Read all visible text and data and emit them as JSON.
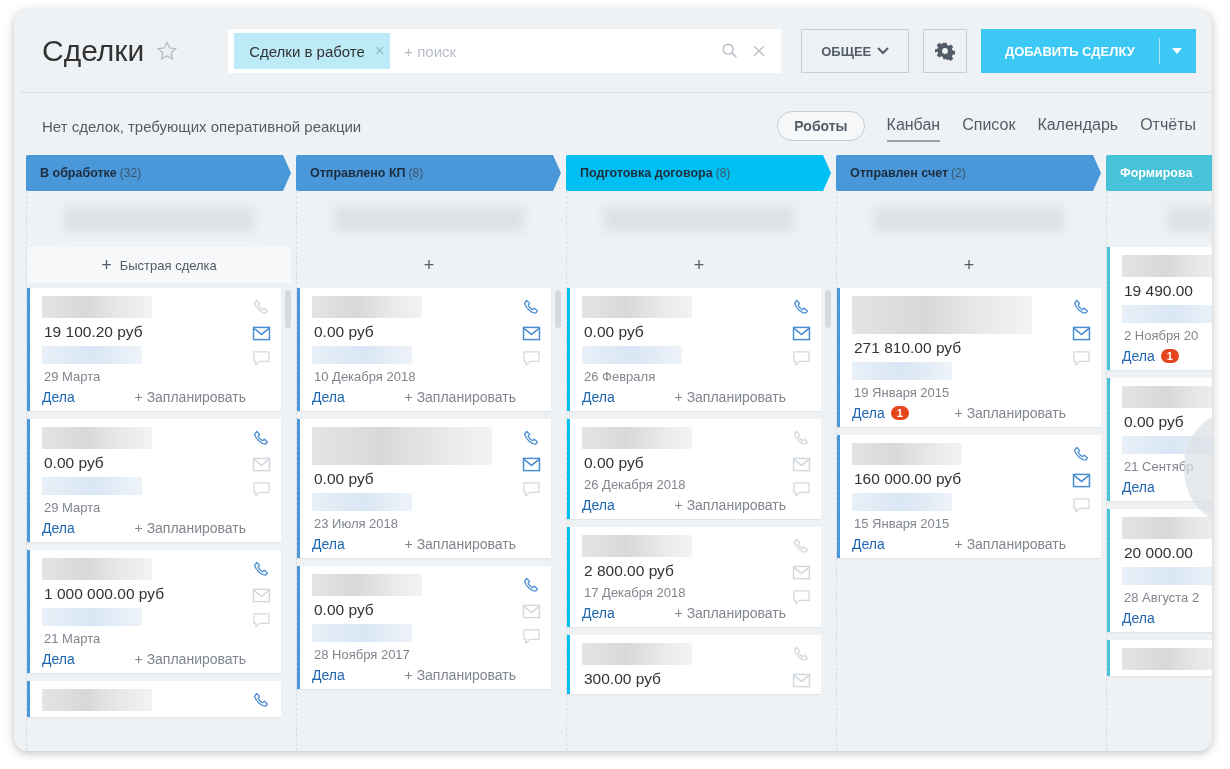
{
  "header": {
    "title": "Сделки",
    "filter": {
      "chip": "Сделки в работе",
      "chip_close": "×",
      "placeholder": "+ поиск"
    },
    "buttons": [
      {
        "kind": "dropdown",
        "label": "ОБЩЕЕ"
      },
      {
        "kind": "settings"
      },
      {
        "kind": "primary",
        "label": "ДОБАВИТЬ СДЕЛКУ"
      }
    ]
  },
  "toolbar": {
    "notice": "Нет сделок, требующих оперативной реакции",
    "robots": "Роботы",
    "views": [
      {
        "label": "Канбан",
        "selected": true
      },
      {
        "label": "Список",
        "selected": false
      },
      {
        "label": "Календарь",
        "selected": false
      },
      {
        "label": "Отчёты",
        "selected": false
      }
    ]
  },
  "columns": [
    {
      "title": "В обработке",
      "count": "(32)",
      "color": "#4a98da",
      "add": {
        "icon": "+",
        "label": "Быстрая сделка"
      },
      "scrollbar": true,
      "cards": [
        {
          "name_wrapped": false,
          "amount": "19 100.20 руб",
          "contact": true,
          "date": "29 Марта",
          "deals": "Дела",
          "plan": "+ Запланировать",
          "icons": [
            {
              "kind": "phone",
              "active": false
            },
            {
              "kind": "mail",
              "active": true
            },
            {
              "kind": "chat",
              "active": false
            }
          ]
        },
        {
          "name_wrapped": false,
          "amount": "0.00 руб",
          "contact": true,
          "date": "29 Марта",
          "deals": "Дела",
          "plan": "+ Запланировать",
          "icons": [
            {
              "kind": "phone",
              "active": true
            },
            {
              "kind": "mail",
              "active": false
            },
            {
              "kind": "chat",
              "active": false
            }
          ]
        },
        {
          "name_wrapped": false,
          "amount": "1 000 000.00 руб",
          "contact": true,
          "date": "21 Марта",
          "deals": "Дела",
          "plan": "+ Запланировать",
          "icons": [
            {
              "kind": "phone",
              "active": true
            },
            {
              "kind": "mail",
              "active": false
            },
            {
              "kind": "chat",
              "active": false
            }
          ]
        },
        {
          "name_wrapped": false,
          "contact": false,
          "icons": [
            {
              "kind": "phone",
              "active": true
            }
          ]
        }
      ]
    },
    {
      "title": "Отправлено КП",
      "count": "(8)",
      "color": "#4a98da",
      "add": {
        "icon": "+"
      },
      "scrollbar": true,
      "cards": [
        {
          "name_wrapped": false,
          "amount": "0.00 руб",
          "contact": true,
          "date": "10 Декабря 2018",
          "deals": "Дела",
          "plan": "+ Запланировать",
          "icons": [
            {
              "kind": "phone",
              "active": true
            },
            {
              "kind": "mail",
              "active": true
            },
            {
              "kind": "chat",
              "active": false
            }
          ]
        },
        {
          "name_wrapped": true,
          "amount": "0.00 руб",
          "contact": true,
          "date": "23 Июля 2018",
          "deals": "Дела",
          "plan": "+ Запланировать",
          "icons": [
            {
              "kind": "phone",
              "active": true
            },
            {
              "kind": "mail",
              "active": true
            },
            {
              "kind": "chat",
              "active": false
            }
          ]
        },
        {
          "name_wrapped": false,
          "amount": "0.00 руб",
          "contact": true,
          "date": "28 Ноября 2017",
          "deals": "Дела",
          "plan": "+ Запланировать",
          "icons": [
            {
              "kind": "phone",
              "active": true
            },
            {
              "kind": "mail",
              "active": false
            },
            {
              "kind": "chat",
              "active": false
            }
          ]
        }
      ]
    },
    {
      "title": "Подготовка договора",
      "count": "(8)",
      "color": "#00bff3",
      "add": {
        "icon": "+"
      },
      "scrollbar": true,
      "cards": [
        {
          "name_wrapped": false,
          "amount": "0.00 руб",
          "contact": true,
          "date": "26 Февраля",
          "deals": "Дела",
          "plan": "+ Запланировать",
          "icons": [
            {
              "kind": "phone",
              "active": true
            },
            {
              "kind": "mail",
              "active": true
            },
            {
              "kind": "chat",
              "active": false
            }
          ]
        },
        {
          "name_wrapped": false,
          "amount": "0.00 руб",
          "contact": false,
          "date": "26 Декабря 2018",
          "deals": "Дела",
          "plan": "+ Запланировать",
          "icons": [
            {
              "kind": "phone",
              "active": false
            },
            {
              "kind": "mail",
              "active": false
            },
            {
              "kind": "chat",
              "active": false
            }
          ]
        },
        {
          "name_wrapped": false,
          "amount": "2 800.00 руб",
          "contact": false,
          "date": "17 Декабря 2018",
          "deals": "Дела",
          "plan": "+ Запланировать",
          "icons": [
            {
              "kind": "phone",
              "active": false
            },
            {
              "kind": "mail",
              "active": false
            },
            {
              "kind": "chat",
              "active": false
            }
          ]
        },
        {
          "name_wrapped": false,
          "amount": "300.00 руб",
          "contact": false,
          "icons": [
            {
              "kind": "phone",
              "active": false
            },
            {
              "kind": "mail",
              "active": false
            }
          ]
        }
      ]
    },
    {
      "title": "Отправлен счет",
      "count": "(2)",
      "color": "#4a98da",
      "add": {
        "icon": "+"
      },
      "scrollbar": false,
      "cards": [
        {
          "name_wrapped": true,
          "amount": "271 810.00 руб",
          "contact": true,
          "date": "19 Января 2015",
          "deals": "Дела",
          "badge": "1",
          "plan": "+ Запланировать",
          "icons": [
            {
              "kind": "phone",
              "active": true
            },
            {
              "kind": "mail",
              "active": true
            },
            {
              "kind": "chat",
              "active": false
            }
          ]
        },
        {
          "name_wrapped": false,
          "amount": "160 000.00 руб",
          "contact": true,
          "date": "15 Января 2015",
          "deals": "Дела",
          "plan": "+ Запланировать",
          "icons": [
            {
              "kind": "phone",
              "active": true
            },
            {
              "kind": "mail",
              "active": true
            },
            {
              "kind": "chat",
              "active": false
            }
          ]
        }
      ]
    },
    {
      "title": "Формирова",
      "color": "#47c3d9",
      "scrollbar": false,
      "cards": [
        {
          "name_wrapped": false,
          "amount": "19 490.00",
          "contact": true,
          "date": "2 Ноября 20",
          "deals": "Дела",
          "badge": "1"
        },
        {
          "name_wrapped": false,
          "amount": "0.00 руб",
          "contact": true,
          "date": "21 Сентябр",
          "deals": "Дела"
        },
        {
          "name_wrapped": false,
          "amount": "20 000.00",
          "contact": true,
          "date": "28 Августа 2",
          "deals": "Дела"
        },
        {
          "name_wrapped": false,
          "contact": false
        }
      ]
    }
  ]
}
